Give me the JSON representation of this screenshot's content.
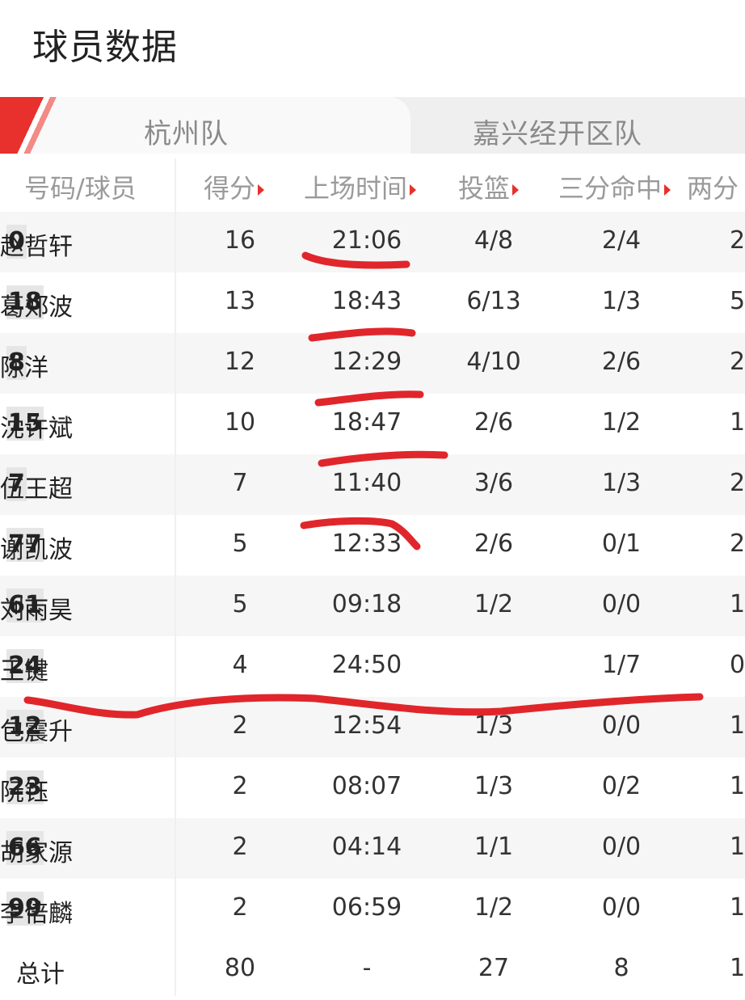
{
  "page": {
    "title": "球员数据"
  },
  "tabs": [
    {
      "label": "杭州队",
      "active": true
    },
    {
      "label": "嘉兴经开区队",
      "active": false
    }
  ],
  "columns": [
    "号码/球员",
    "得分",
    "上场时间",
    "投篮",
    "三分命中",
    "两分"
  ],
  "players": [
    {
      "number": "0",
      "name": "赵哲轩",
      "pts": "16",
      "min": "21:06",
      "fg": "4/8",
      "three": "2/4",
      "two": "2/"
    },
    {
      "number": "18",
      "name": "葛郑波",
      "pts": "13",
      "min": "18:43",
      "fg": "6/13",
      "three": "1/3",
      "two": "5/"
    },
    {
      "number": "8",
      "name": "陈洋",
      "pts": "12",
      "min": "12:29",
      "fg": "4/10",
      "three": "2/6",
      "two": "2/"
    },
    {
      "number": "15",
      "name": "沈许斌",
      "pts": "10",
      "min": "18:47",
      "fg": "2/6",
      "three": "1/2",
      "two": "1/"
    },
    {
      "number": "7",
      "name": "伍王超",
      "pts": "7",
      "min": "11:40",
      "fg": "3/6",
      "three": "1/3",
      "two": "2/"
    },
    {
      "number": "77",
      "name": "谢凯波",
      "pts": "5",
      "min": "12:33",
      "fg": "2/6",
      "three": "0/1",
      "two": "2/"
    },
    {
      "number": "61",
      "name": "刘雨昊",
      "pts": "5",
      "min": "09:18",
      "fg": "1/2",
      "three": "0/0",
      "two": "1/"
    },
    {
      "number": "24",
      "name": "王键",
      "pts": "4",
      "min": "24:50",
      "fg": "",
      "three": "1/7",
      "two": "0/"
    },
    {
      "number": "12",
      "name": "包震升",
      "pts": "2",
      "min": "12:54",
      "fg": "1/3",
      "three": "0/0",
      "two": "1/"
    },
    {
      "number": "23",
      "name": "阮钰",
      "pts": "2",
      "min": "08:07",
      "fg": "1/3",
      "three": "0/2",
      "two": "1/"
    },
    {
      "number": "66",
      "name": "胡家源",
      "pts": "2",
      "min": "04:14",
      "fg": "1/1",
      "three": "0/0",
      "two": "1/"
    },
    {
      "number": "99",
      "name": "李倍麟",
      "pts": "2",
      "min": "06:59",
      "fg": "1/2",
      "three": "0/0",
      "two": "1/"
    }
  ],
  "totals": {
    "label": "总计",
    "pts": "80",
    "min": "-",
    "fg": "27",
    "three": "8",
    "two": "1"
  },
  "colors": {
    "accent": "#e8302c",
    "annotation": "#e0262b"
  }
}
